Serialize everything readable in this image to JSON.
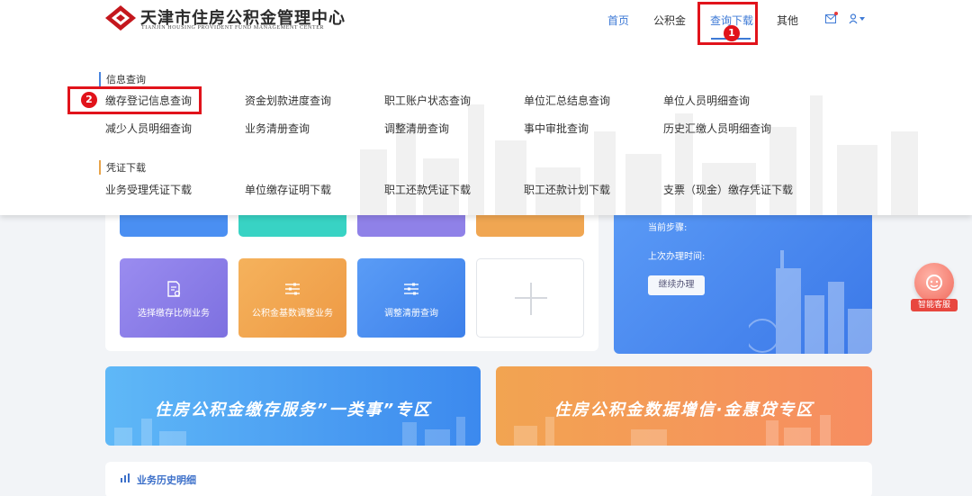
{
  "colors": {
    "accent_blue": "#3e7ad6",
    "annotation_red": "#e1131b",
    "tile_purple": "#8f81e8",
    "tile_orange": "#f0a652",
    "tile_blue": "#4a8ff2",
    "tile_teal": "#38d3c4"
  },
  "header": {
    "org_name": "天津市住房公积金管理中心",
    "org_name_en": "TIANJIN HOUSING PROVIDENT FUND MANAGEMENT CENTER",
    "logo_icon": "diamond-logo-icon",
    "nav": {
      "home": "首页",
      "fund": "公积金",
      "query": "查询下载",
      "other": "其他"
    },
    "mail_icon": "mail-icon",
    "user_icon": "user-icon"
  },
  "dropdown": {
    "info_section": "信息查询",
    "info_links": [
      "缴存登记信息查询",
      "资金划款进度查询",
      "职工账户状态查询",
      "单位汇总结息查询",
      "单位人员明细查询",
      "减少人员明细查询",
      "业务清册查询",
      "调整清册查询",
      "事中审批查询",
      "历史汇缴人员明细查询"
    ],
    "voucher_section": "凭证下载",
    "voucher_links": [
      "业务受理凭证下载",
      "单位缴存证明下载",
      "职工还款凭证下载",
      "职工还款计划下载",
      "支票（现金）缴存凭证下载"
    ]
  },
  "annotations": {
    "step1": "1",
    "step2": "2"
  },
  "tiles": [
    {
      "label": "选择缴存比例业务",
      "icon": "document-icon"
    },
    {
      "label": "公积金基数调整业务",
      "icon": "sliders-icon"
    },
    {
      "label": "调整清册查询",
      "icon": "sliders-icon"
    }
  ],
  "add_tile_icon": "plus-icon",
  "progress_card": {
    "current_step_label": "当前步骤:",
    "last_time_label": "上次办理时间:",
    "continue_button": "继续办理"
  },
  "banners": {
    "left": "住房公积金缴存服务”一类事”专区",
    "right": "住房公积金数据增信·金惠贷专区"
  },
  "history": {
    "title": "业务历史明细",
    "icon": "history-icon"
  },
  "service": {
    "label": "智能客服",
    "icon": "customer-service-icon"
  }
}
